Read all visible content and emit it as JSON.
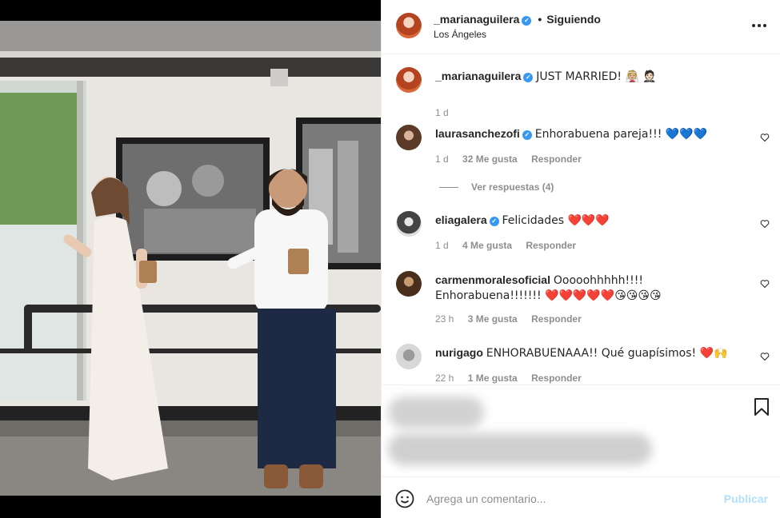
{
  "post": {
    "author": "_marianaguilera",
    "location": "Los Ángeles",
    "follow_status": "Siguiendo",
    "dot": "•",
    "caption": "JUST MARRIED! 👰🏼 🤵🏻",
    "caption_time": "1 d"
  },
  "comments": [
    {
      "user": "laurasanchezofi",
      "verified": true,
      "text": "Enhorabuena pareja!!! 💙💙💙",
      "time": "1 d",
      "likes": "32 Me gusta",
      "reply": "Responder",
      "view_replies": "Ver respuestas (4)"
    },
    {
      "user": "eliagalera",
      "verified": true,
      "text": "Felicidades ❤️❤️❤️",
      "time": "1 d",
      "likes": "4 Me gusta",
      "reply": "Responder"
    },
    {
      "user": "carmenmoralesoficial",
      "verified": false,
      "text": "Ooooohhhhh!!!! Enhorabuena!!!!!!! ❤️❤️❤️❤️❤️😘😘😘😘",
      "time": "23 h",
      "likes": "3 Me gusta",
      "reply": "Responder"
    },
    {
      "user": "nurigago",
      "verified": false,
      "text": "ENHORABUENAAA!! Qué guapísimos! ❤️🙌",
      "time": "22 h",
      "likes": "1 Me gusta",
      "reply": "Responder"
    }
  ],
  "add_comment": {
    "placeholder": "Agrega un comentario...",
    "publish_label": "Publicar"
  },
  "colors": {
    "verified": "#3897f0",
    "meta_text": "#8e8e8e",
    "publish_disabled": "#b2dffc",
    "border": "#efefef"
  },
  "icons": [
    "more-options-icon",
    "verified-badge-icon",
    "heart-icon",
    "bookmark-icon",
    "emoji-icon"
  ]
}
